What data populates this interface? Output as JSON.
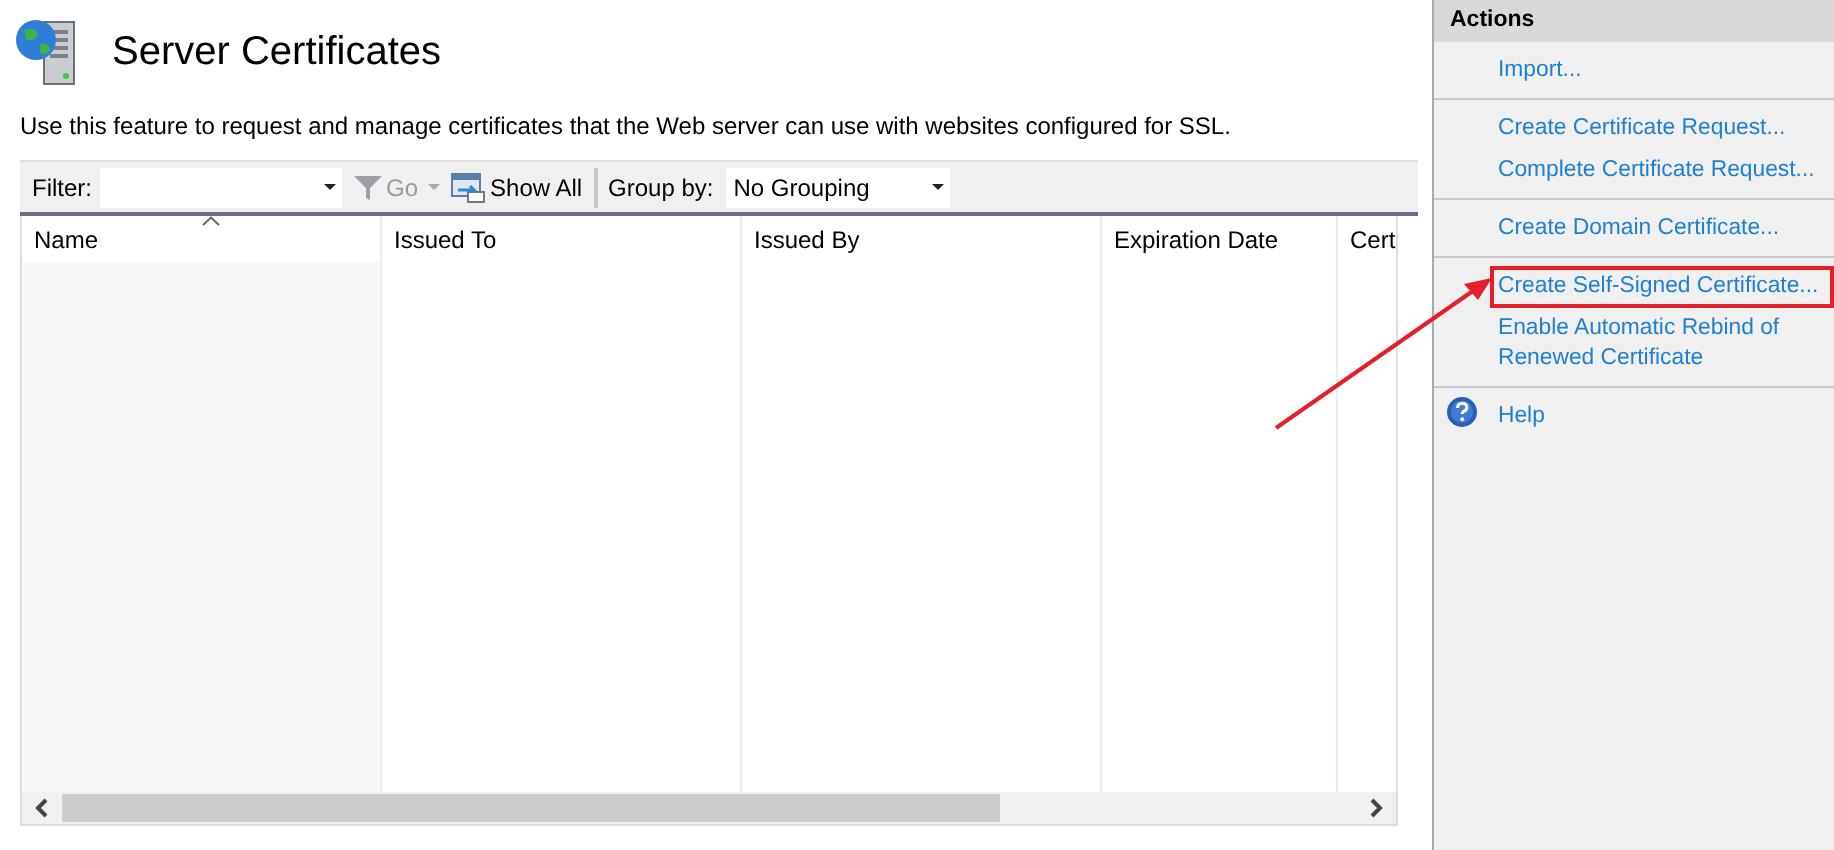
{
  "page": {
    "title": "Server Certificates",
    "description": "Use this feature to request and manage certificates that the Web server can use with websites configured for SSL."
  },
  "toolbar": {
    "filter_label": "Filter:",
    "go_label": "Go",
    "go_disabled": true,
    "show_all_label": "Show All",
    "group_by_label": "Group by:",
    "group_by_value": "No Grouping"
  },
  "table": {
    "columns": [
      {
        "label": "Name",
        "sorted": true
      },
      {
        "label": "Issued To",
        "sorted": false
      },
      {
        "label": "Issued By",
        "sorted": false
      },
      {
        "label": "Expiration Date",
        "sorted": false
      },
      {
        "label": "Cert",
        "sorted": false
      }
    ]
  },
  "actions": {
    "title": "Actions",
    "groups": [
      [
        {
          "kind": "link",
          "label": "Import...",
          "highlighted": false
        }
      ],
      [
        {
          "kind": "link",
          "label": "Create Certificate Request...",
          "highlighted": false
        },
        {
          "kind": "link",
          "label": "Complete Certificate Request...",
          "highlighted": false
        }
      ],
      [
        {
          "kind": "link",
          "label": "Create Domain Certificate...",
          "highlighted": false
        }
      ],
      [
        {
          "kind": "link",
          "label": "Create Self-Signed Certificate...",
          "highlighted": true
        },
        {
          "kind": "link",
          "label": "Enable Automatic Rebind of Renewed Certificate",
          "highlighted": false
        }
      ],
      [
        {
          "kind": "help",
          "label": "Help",
          "highlighted": false
        }
      ]
    ]
  }
}
